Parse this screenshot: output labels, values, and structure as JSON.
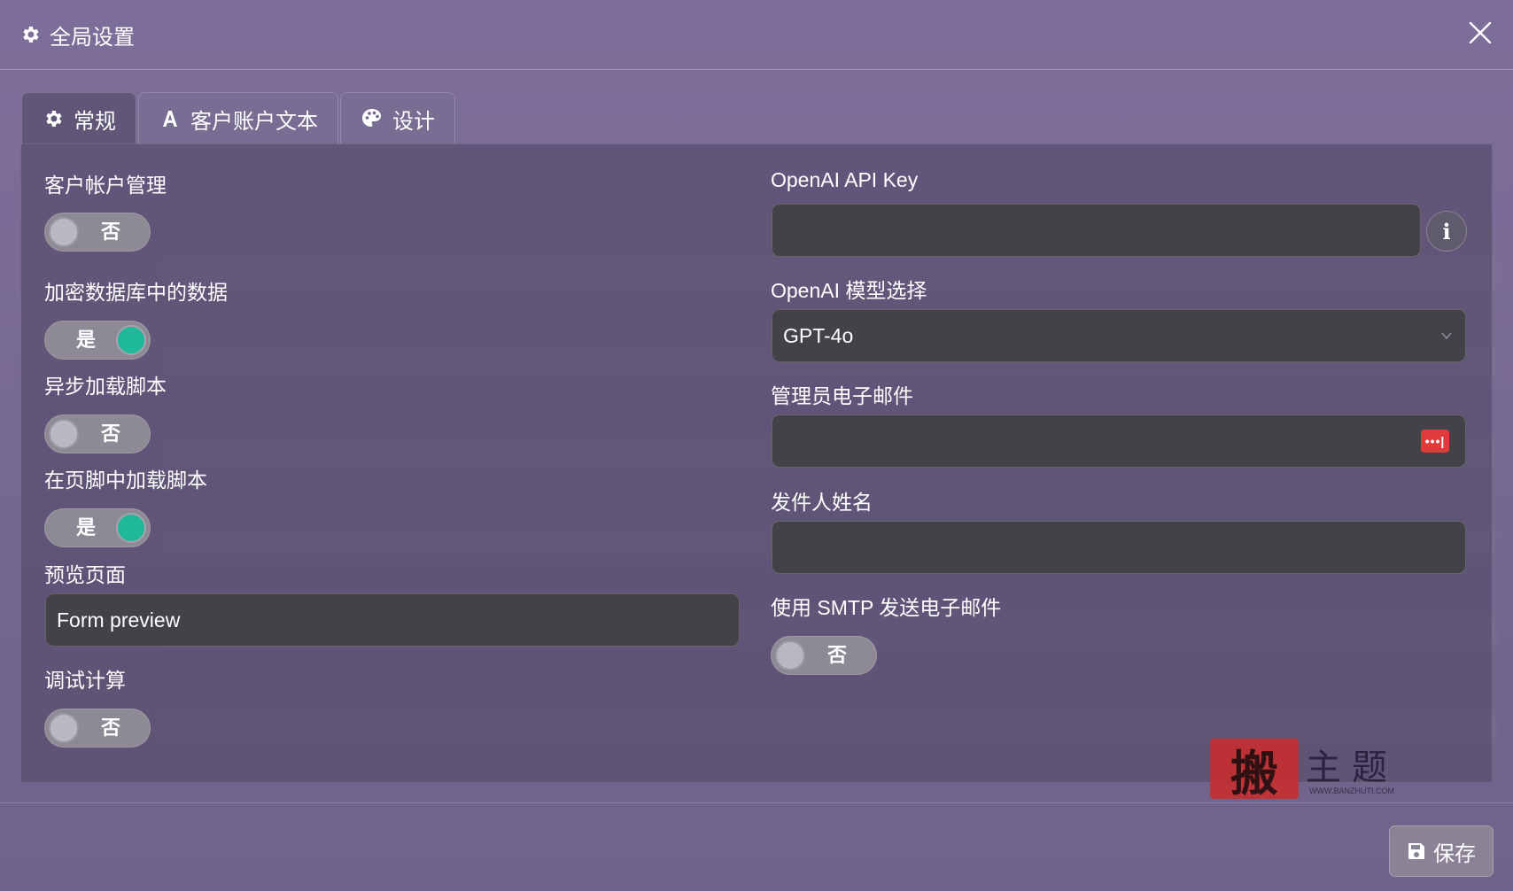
{
  "dialog": {
    "title": "全局设置",
    "close_icon": "close-icon",
    "title_icon": "gear-icon"
  },
  "tabs": [
    {
      "label": "常规",
      "icon": "gear-icon",
      "active": true
    },
    {
      "label": "客户账户文本",
      "icon": "font-icon",
      "active": false
    },
    {
      "label": "设计",
      "icon": "palette-icon",
      "active": false
    }
  ],
  "left": {
    "customer_account_mgmt": {
      "label": "客户帐户管理",
      "toggle": "否",
      "on": false
    },
    "encrypt_db": {
      "label": "加密数据库中的数据",
      "toggle": "是",
      "on": true
    },
    "async_scripts": {
      "label": "异步加载脚本",
      "toggle": "否",
      "on": false
    },
    "footer_scripts": {
      "label": "在页脚中加载脚本",
      "toggle": "是",
      "on": true
    },
    "preview_page": {
      "label": "预览页面",
      "value": "Form preview"
    },
    "debug_calc": {
      "label": "调试计算",
      "toggle": "否",
      "on": false
    }
  },
  "right": {
    "api_key": {
      "label": "OpenAI API Key",
      "value": "",
      "info_icon": "info-icon"
    },
    "model": {
      "label": "OpenAI 模型选择",
      "value": "GPT-4o",
      "icon": "chevron-down-icon"
    },
    "admin_email": {
      "label": "管理员电子邮件",
      "value": "",
      "icon": "password-manager-icon"
    },
    "sender_name": {
      "label": "发件人姓名",
      "value": ""
    },
    "smtp": {
      "label": "使用 SMTP 发送电子邮件",
      "toggle": "否",
      "on": false
    }
  },
  "footer": {
    "save_label": "保存",
    "save_icon": "save-icon"
  },
  "watermark": {
    "seal": "搬",
    "text": "主题",
    "url": "WWW.BANZHUTI.COM"
  },
  "colors": {
    "toggle_on": "#1fb89a",
    "password_icon": "#e03a3a",
    "input_bg": "#444249"
  }
}
